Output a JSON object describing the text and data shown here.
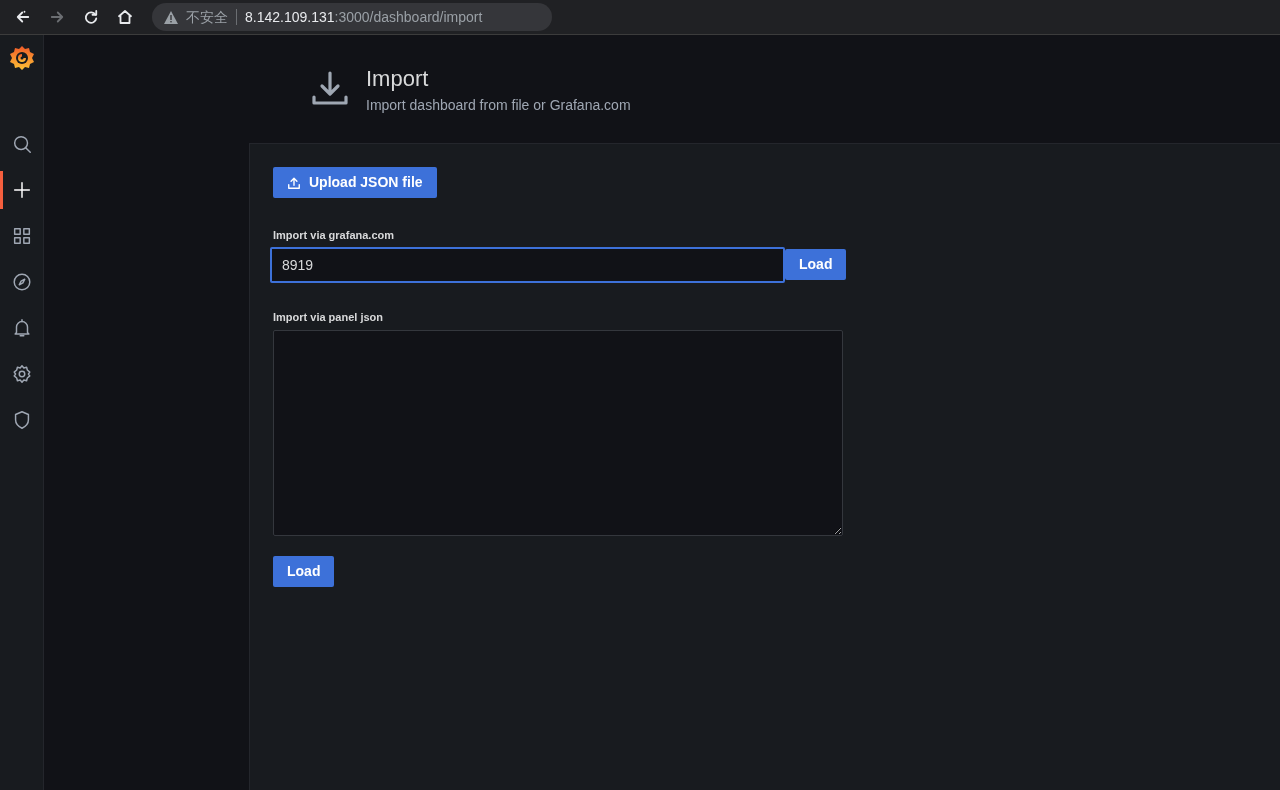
{
  "browser": {
    "nav_buttons": [
      {
        "kind": "back",
        "disabled": false
      },
      {
        "kind": "forward",
        "disabled": true
      },
      {
        "kind": "reload",
        "disabled": false
      },
      {
        "kind": "home",
        "disabled": false
      }
    ],
    "security_label": "不安全",
    "url_host": "8.142.109.131",
    "url_path": ":3000/dashboard/import"
  },
  "sidebar": {
    "items": [
      {
        "kind": "search",
        "selected": false
      },
      {
        "kind": "create",
        "selected": true
      },
      {
        "kind": "dashboards",
        "selected": false
      },
      {
        "kind": "explore",
        "selected": false
      },
      {
        "kind": "alerting",
        "selected": false
      },
      {
        "kind": "configuration",
        "selected": false
      },
      {
        "kind": "shield",
        "selected": false
      }
    ]
  },
  "header": {
    "title": "Import",
    "subtitle": "Import dashboard from file or Grafana.com"
  },
  "upload_button": "Upload JSON file",
  "grafana_import": {
    "label": "Import via grafana.com",
    "value": "8919",
    "focused": true,
    "button": "Load"
  },
  "panel_json": {
    "label": "Import via panel json",
    "button": "Load"
  }
}
